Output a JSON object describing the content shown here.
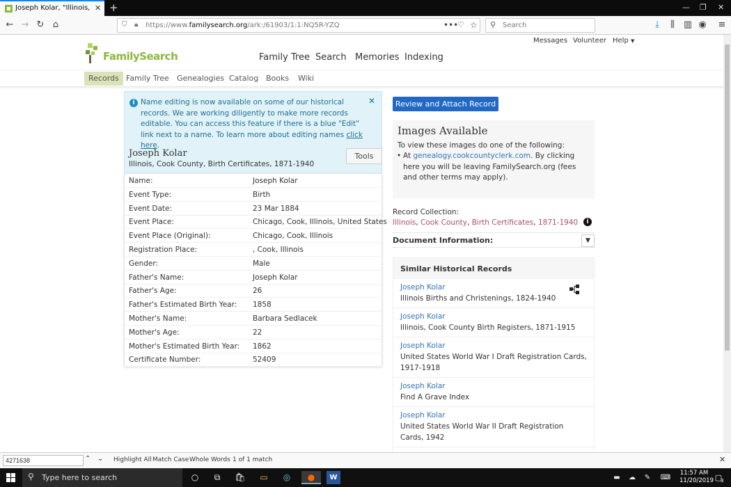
{
  "browser": {
    "tab_title": "Joseph Kolar, \"Illinois, Cook Co",
    "url_prefix": "https://www.",
    "url_domain": "familysearch.org",
    "url_path": "/ark:/61903/1:1:NQ5R-YZQ",
    "search_placeholder": "Search"
  },
  "site": {
    "logo_text": "FamilySearch",
    "util_links": [
      "Messages",
      "Volunteer",
      "Help"
    ],
    "main_nav": [
      "Family Tree",
      "Search",
      "Memories",
      "Indexing"
    ],
    "sub_nav": [
      "Records",
      "Family Tree",
      "Genealogies",
      "Catalog",
      "Books",
      "Wiki"
    ]
  },
  "notice": {
    "text": "Name editing is now available on some of our historical records. We are working diligently to make more records editable. You can access this feature if there is a blue \"Edit\" link next to a name. To learn more about editing names ",
    "link": "click here",
    "end": "."
  },
  "record": {
    "name": "Joseph Kolar",
    "collection": "Illinois, Cook County, Birth Certificates, 1871-1940",
    "tools_label": "Tools",
    "facts": [
      {
        "label": "Name:",
        "value": "Joseph Kolar",
        "link": false
      },
      {
        "label": "Event Type:",
        "value": "Birth",
        "link": false
      },
      {
        "label": "Event Date:",
        "value": "23 Mar 1884",
        "link": false
      },
      {
        "label": "Event Place:",
        "value": "Chicago, Cook, Illinois, United States",
        "link": false
      },
      {
        "label": "Event Place (Original):",
        "value": "Chicago, Cook, Illinois",
        "link": false
      },
      {
        "label": "Registration Place:",
        "value": ", Cook, Illinois",
        "link": false
      },
      {
        "label": "Gender:",
        "value": "Male",
        "link": false
      },
      {
        "label": "Father's Name:",
        "value": "Joseph Kolar",
        "link": true
      },
      {
        "label": "Father's Age:",
        "value": "26",
        "link": false
      },
      {
        "label": "Father's Estimated Birth Year:",
        "value": "1858",
        "link": false
      },
      {
        "label": "Mother's Name:",
        "value": "Barbara Sedlacek",
        "link": true
      },
      {
        "label": "Mother's Age:",
        "value": "22",
        "link": false
      },
      {
        "label": "Mother's Estimated Birth Year:",
        "value": "1862",
        "link": false
      },
      {
        "label": "Certificate Number:",
        "value": "52409",
        "link": false
      }
    ]
  },
  "sidebar": {
    "review_button": "Review and Attach Record",
    "images_title": "Images Available",
    "images_intro": "To view these images do one of the following:",
    "images_bullet_pre": "At ",
    "images_bullet_link": "genealogy.cookcountyclerk.com",
    "images_bullet_post": ". By clicking here you will be leaving FamilySearch.org (fees and other terms may apply).",
    "record_collection_label": "Record Collection:",
    "record_collection_links": [
      "Illinois",
      "Cook County",
      "Birth Certificates",
      "1871-1940"
    ],
    "doc_info_label": "Document Information:",
    "similar_title": "Similar Historical Records",
    "similar": [
      {
        "name": "Joseph Kolar",
        "collection": "Illinois Births and Christenings, 1824-1940"
      },
      {
        "name": "Joseph Kolar",
        "collection": "Illinois, Cook County Birth Registers, 1871-1915"
      },
      {
        "name": "Joseph Kolar",
        "collection": "United States World War I Draft Registration Cards, 1917-1918"
      },
      {
        "name": "Joseph Kolar",
        "collection": "Find A Grave Index"
      },
      {
        "name": "Joseph Kolar",
        "collection": "United States World War II Draft Registration Cards, 1942"
      }
    ]
  },
  "findbar": {
    "query": "4271638",
    "highlight_all": "Highlight All",
    "match_case": "Match Case",
    "whole_words": "Whole Words",
    "status": "1 of 1 match"
  },
  "taskbar": {
    "search_placeholder": "Type here to search",
    "time": "11:57 AM",
    "date": "11/20/2019",
    "notification_count": "3"
  },
  "colors": {
    "link": "#3374b6",
    "accent_button": "#2169c4",
    "notice_bg": "#e1f3f8",
    "brand_green": "#8cb83f"
  }
}
